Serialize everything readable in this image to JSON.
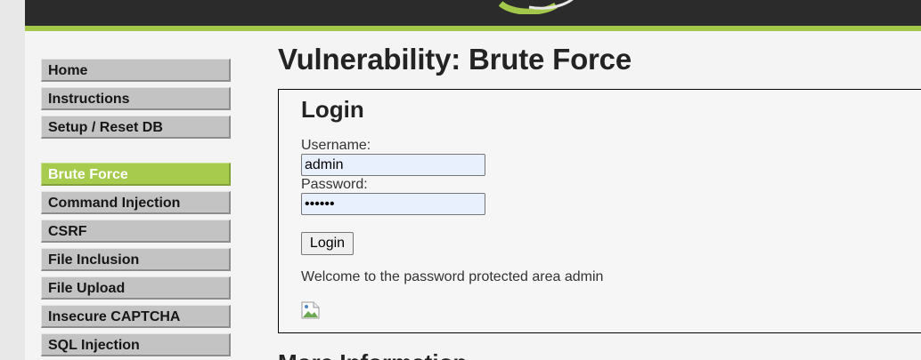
{
  "menu": {
    "group1": [
      {
        "label": "Home"
      },
      {
        "label": "Instructions"
      },
      {
        "label": "Setup / Reset DB"
      }
    ],
    "group2": [
      {
        "label": "Brute Force",
        "active": true
      },
      {
        "label": "Command Injection"
      },
      {
        "label": "CSRF"
      },
      {
        "label": "File Inclusion"
      },
      {
        "label": "File Upload"
      },
      {
        "label": "Insecure CAPTCHA"
      },
      {
        "label": "SQL Injection"
      }
    ]
  },
  "main": {
    "title": "Vulnerability: Brute Force",
    "login": {
      "heading": "Login",
      "username_label": "Username:",
      "username_value": "admin",
      "password_label": "Password:",
      "password_value": "passwd",
      "button_label": "Login",
      "welcome_message": "Welcome to the password protected area admin",
      "image_icon": "broken-image-icon"
    },
    "more_info_heading": "More Information"
  },
  "colors": {
    "header": "#2b2b2b",
    "accent": "#a3c74a",
    "menu_item": "#c3c3c3",
    "menu_active": "#a7cb4d"
  }
}
